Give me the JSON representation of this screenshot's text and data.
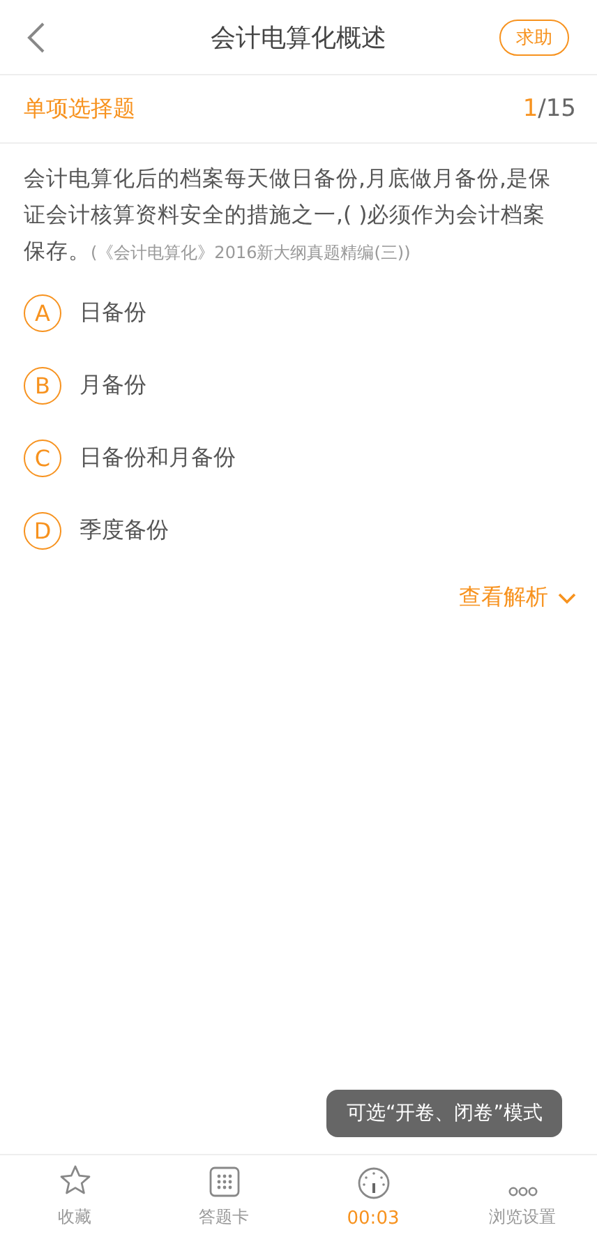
{
  "header": {
    "title": "会计电算化概述",
    "help_button": "求助"
  },
  "section": {
    "label": "单项选择题",
    "current": "1",
    "total": "/15"
  },
  "question": {
    "text": "会计电算化后的档案每天做日备份,月底做月备份,是保证会计核算资料安全的措施之一,( )必须作为会计档案保存。",
    "source": "(《会计电算化》2016新大纲真题精编(三))"
  },
  "options": [
    {
      "letter": "A",
      "text": "日备份"
    },
    {
      "letter": "B",
      "text": "月备份"
    },
    {
      "letter": "C",
      "text": "日备份和月备份"
    },
    {
      "letter": "D",
      "text": "季度备份"
    }
  ],
  "analysis_link": "查看解析",
  "tooltip": "可选“开卷、闭卷”模式",
  "tab_bar": [
    {
      "kind": "star",
      "label": "收藏",
      "highlighted": false
    },
    {
      "kind": "grid",
      "label": "答题卡",
      "highlighted": false
    },
    {
      "kind": "timer",
      "label": "00:03",
      "highlighted": true
    },
    {
      "kind": "more",
      "label": "浏览设置",
      "highlighted": false
    }
  ]
}
